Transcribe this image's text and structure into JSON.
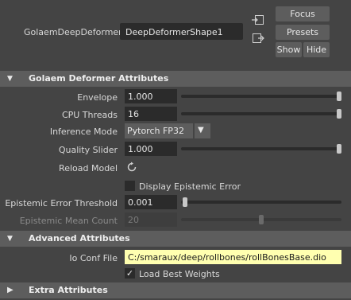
{
  "header": {
    "node_label": "GolaemDeepDeformer:",
    "node_name": "DeepDeformerShape1",
    "focus_label": "Focus",
    "presets_label": "Presets",
    "show_label": "Show",
    "hide_label": "Hide"
  },
  "sections": {
    "deformer": "Golaem Deformer Attributes",
    "advanced": "Advanced Attributes",
    "extra": "Extra Attributes"
  },
  "attributes": {
    "envelope": {
      "label": "Envelope",
      "value": "1.000",
      "slider": 1.0
    },
    "cpu_threads": {
      "label": "CPU Threads",
      "value": "16",
      "slider": 1.0
    },
    "inference_mode": {
      "label": "Inference Mode",
      "value": "Pytorch FP32"
    },
    "quality_slider": {
      "label": "Quality Slider",
      "value": "1.000",
      "slider": 1.0
    },
    "reload_model": {
      "label": "Reload Model"
    },
    "display_epistemic_error": {
      "label": "Display Epistemic Error",
      "checked": false
    },
    "epistemic_error_threshold": {
      "label": "Epistemic Error Threshold",
      "value": "0.001",
      "slider": 0.0
    },
    "epistemic_mean_count": {
      "label": "Epistemic Mean Count",
      "value": "20",
      "slider": 0.5
    }
  },
  "advanced": {
    "io_conf_file": {
      "label": "Io Conf File",
      "value": "C:/smaraux/deep/rollbones/rollBonesBase.dio"
    },
    "load_best_weights": {
      "label": "Load Best Weights",
      "checked": true
    }
  },
  "icons": {
    "reload": "refresh-icon",
    "collapse": "triangle-down-icon",
    "expand": "triangle-right-icon"
  },
  "colors": {
    "background": "#444444",
    "section_bar": "#5d5d5d",
    "field": "#2b2b2b",
    "file_field": "#ffffb0"
  }
}
